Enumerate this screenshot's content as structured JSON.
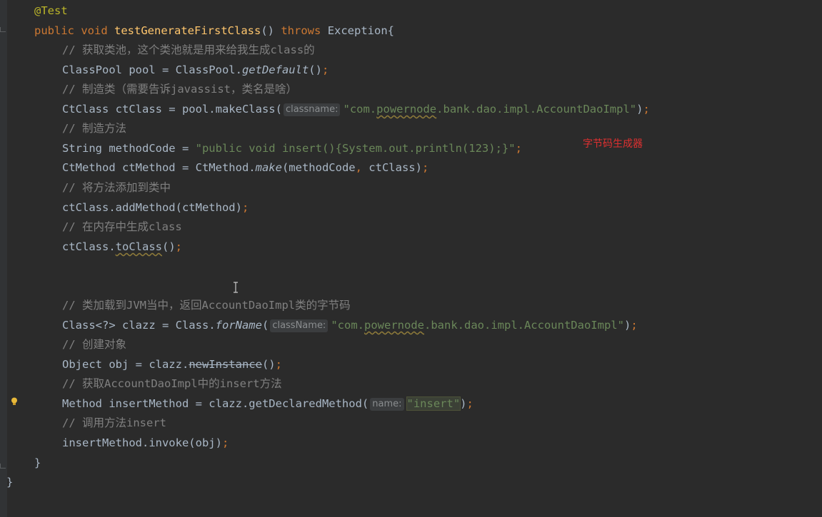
{
  "editor": {
    "lines": {
      "annotation": "@Test",
      "method_public": "public",
      "method_void": "void",
      "method_name": "testGenerateFirstClass",
      "method_parens": "()",
      "method_throws": "throws",
      "method_exception": "Exception{",
      "c1": "// 获取类池，这个类池就是用来给我生成class的",
      "pool_decl": "ClassPool pool = ClassPool.",
      "pool_call": "getDefault",
      "pool_end": "()",
      "c2": "// 制造类（需要告诉javassist，类名是啥）",
      "ct_decl": "CtClass ctClass = pool.makeClass(",
      "ct_hint": "classname:",
      "ct_str_a": "\"com.",
      "ct_str_b": "powernode",
      "ct_str_c": ".bank.dao.impl.AccountDaoImpl\"",
      "ct_end": ")",
      "c3": "// 制造方法",
      "mc_decl": "String methodCode = ",
      "mc_str": "\"public void insert(){System.out.println(123);}\"",
      "cm_decl": "CtMethod ctMethod = CtMethod.",
      "cm_call": "make",
      "cm_args_a": "(methodCode",
      "cm_args_b": " ctClass)",
      "c4": "// 将方法添加到类中",
      "add_call": "ctClass.addMethod(ctMethod)",
      "c5": "// 在内存中生成class",
      "to_obj": "ctClass.",
      "to_call": "toClass",
      "to_end": "()",
      "c6": "// 类加载到JVM当中，返回AccountDaoImpl类的字节码",
      "cz_decl": "Class<?> clazz = Class.",
      "cz_call": "forName",
      "cz_paren": "(",
      "cz_hint": "className:",
      "cz_str_a": "\"com.",
      "cz_str_b": "powernode",
      "cz_str_c": ".bank.dao.impl.AccountDaoImpl\"",
      "cz_end": ")",
      "c7": "// 创建对象",
      "obj_decl": "Object obj = clazz.",
      "obj_call": "newInstance",
      "obj_end": "()",
      "c8": "// 获取AccountDaoImpl中的insert方法",
      "im_decl": "Method insertMethod = clazz.getDeclaredMethod(",
      "im_hint": "name:",
      "im_str": "\"insert\"",
      "im_end": ")",
      "c9": "// 调用方法insert",
      "inv_call": "insertMethod.invoke(obj)",
      "semi": ";",
      "comma": ",",
      "close_method": "}",
      "close_class": "}"
    }
  },
  "overlay": {
    "label": "字节码生成器",
    "color": "#e03030"
  },
  "icons": {
    "bulb": "intention-bulb-icon",
    "cursor": "text-cursor-icon"
  }
}
